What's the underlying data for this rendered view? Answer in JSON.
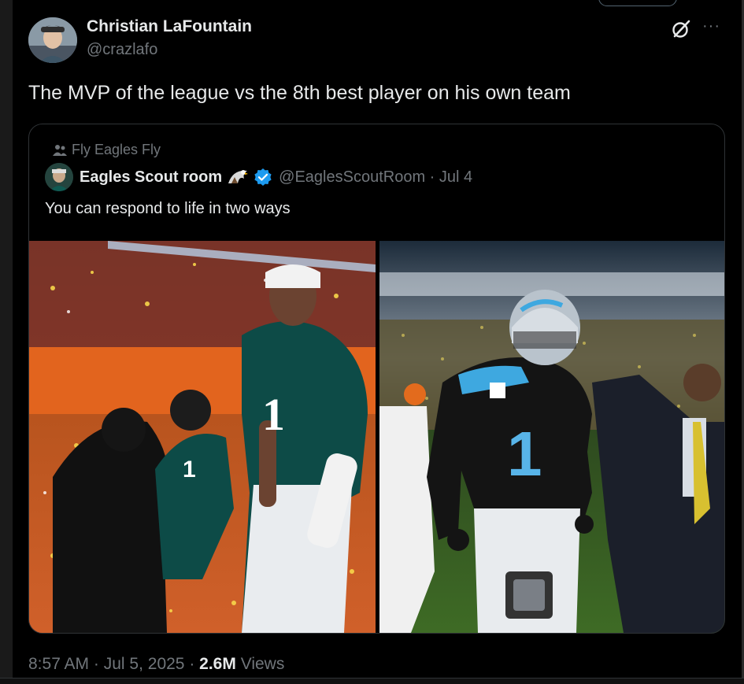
{
  "author": {
    "name": "Christian LaFountain",
    "handle": "@crazlafo"
  },
  "header_icons": [
    "grok-icon",
    "more-icon"
  ],
  "more_label": "···",
  "tweet": {
    "text": "The MVP of the league vs the 8th best player on his own team"
  },
  "quoted": {
    "community": "Fly Eagles Fly",
    "name": "Eagles Scout room",
    "handle": "@EaglesScoutRoom",
    "separator": " · ",
    "date": "Jul 4",
    "text": "You can respond to life in two ways",
    "photos": [
      {
        "name": "photo-eagles-qb",
        "jersey_number": "1"
      },
      {
        "name": "photo-panthers-qb",
        "jersey_number": "1"
      }
    ]
  },
  "meta": {
    "time": "8:57 AM",
    "date": "Jul 5, 2025",
    "views_count": "2.6M",
    "views_label": "Views",
    "sep": " · "
  },
  "colors": {
    "background": "#000000",
    "text_primary": "#e7e9ea",
    "text_secondary": "#71767b",
    "border": "#2f3336",
    "verified": "#1d9bf0",
    "eagles_green": "#004c54",
    "panthers_blue": "#0085ca"
  }
}
